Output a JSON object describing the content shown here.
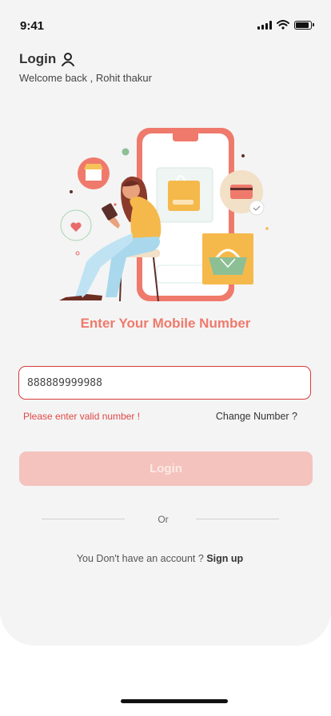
{
  "status_bar": {
    "time": "9:41"
  },
  "header": {
    "title": "Login",
    "subtitle": "Welcome back , Rohit thakur"
  },
  "main": {
    "heading": "Enter Your Mobile Number",
    "phone_value": "888889999988",
    "error_text": "Please enter valid number !",
    "change_number_label": "Change Number ?",
    "login_label": "Login",
    "or_label": "Or",
    "no_account_text": "You Don't have an account ?",
    "signup_label": "Sign up"
  },
  "colors": {
    "accent": "#ef7a6c",
    "error": "#e04848",
    "button_disabled": "#f4c3bd",
    "background": "#f4f4f4"
  },
  "icons": [
    "user-icon",
    "cellular-signal-icon",
    "wifi-icon",
    "battery-icon"
  ]
}
